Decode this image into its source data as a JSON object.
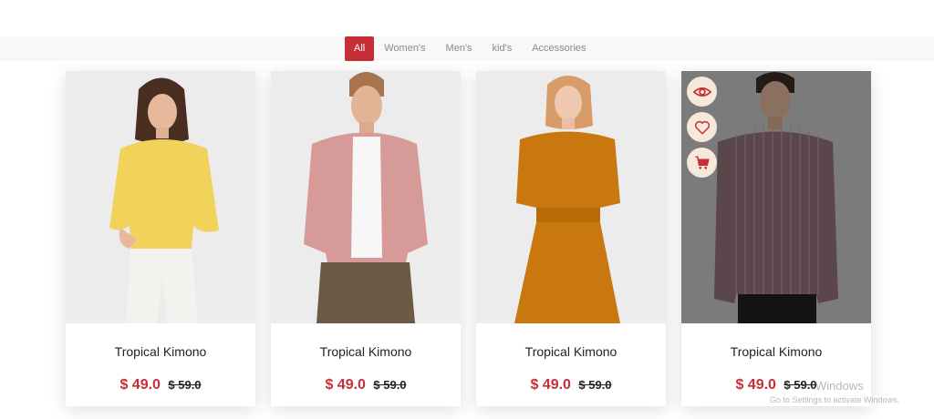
{
  "filters": {
    "tabs": [
      {
        "label": "All",
        "active": true
      },
      {
        "label": "Women's",
        "active": false
      },
      {
        "label": "Men's",
        "active": false
      },
      {
        "label": "kid's",
        "active": false
      },
      {
        "label": "Accessories",
        "active": false
      }
    ]
  },
  "products": [
    {
      "title": "Tropical Kimono",
      "price": "$ 49.0",
      "old_price": "$ 59.0",
      "image": "woman-yellow-blouse",
      "shirt_color": "#f1d25a"
    },
    {
      "title": "Tropical Kimono",
      "price": "$ 49.0",
      "old_price": "$ 59.0",
      "image": "man-pink-shirt",
      "shirt_color": "#d69a98"
    },
    {
      "title": "Tropical Kimono",
      "price": "$ 49.0",
      "old_price": "$ 59.0",
      "image": "woman-orange-dress",
      "shirt_color": "#c8780f"
    },
    {
      "title": "Tropical Kimono",
      "price": "$ 49.0",
      "old_price": "$ 59.0",
      "image": "man-striped-shirt",
      "shirt_color": "#8a6c74"
    }
  ],
  "hover_actions": [
    {
      "icon": "eye-icon"
    },
    {
      "icon": "heart-icon"
    },
    {
      "icon": "cart-icon"
    }
  ],
  "watermark": {
    "line1": "Windows",
    "line2": "Go to Settings to activate Windows."
  },
  "colors": {
    "accent": "#c72f36",
    "action_bg": "#f6e9d9"
  }
}
